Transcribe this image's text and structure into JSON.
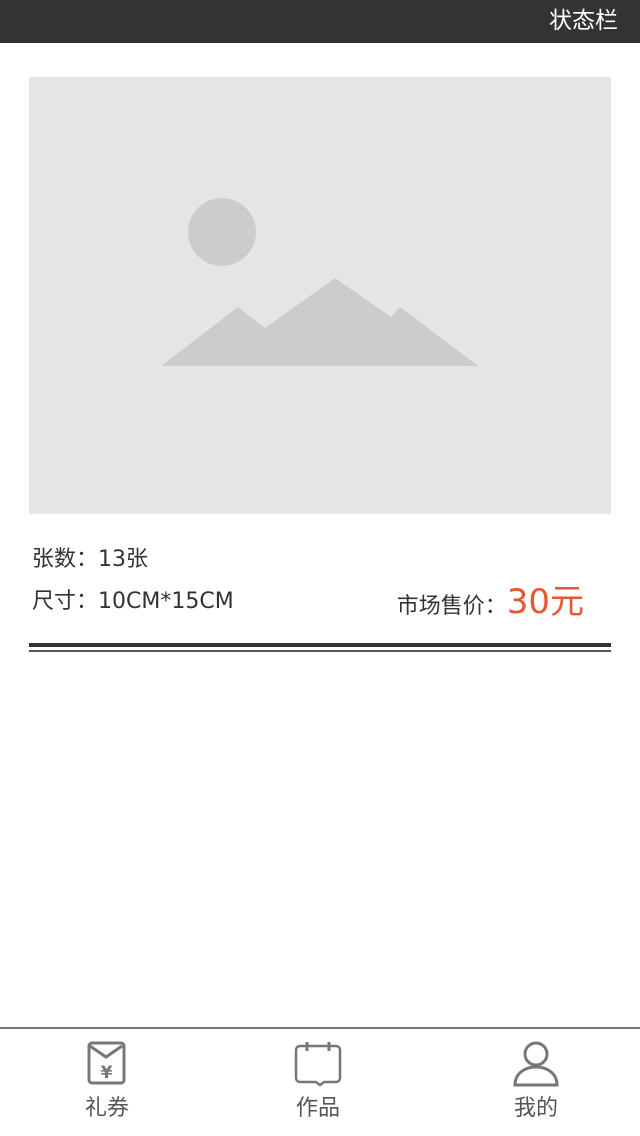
{
  "status_bar": {
    "text": "状态栏"
  },
  "photo": {
    "icon": "image-placeholder-icon"
  },
  "details": {
    "sheets_text": "张数：13张",
    "size_text": "尺寸：10CM*15CM",
    "price_label": "市场售价：",
    "price_value": "30元"
  },
  "tab_bar": {
    "items": [
      {
        "label": "礼券",
        "icon": "coupon-icon"
      },
      {
        "label": "作品",
        "icon": "calendar-icon"
      },
      {
        "label": "我的",
        "icon": "user-icon"
      }
    ]
  },
  "colors": {
    "status_bar_bg": "#333333",
    "price_accent": "#e9572e",
    "placeholder_bg": "#e5e5e5",
    "placeholder_shape": "#cccccc",
    "tab_icon": "#777777"
  }
}
